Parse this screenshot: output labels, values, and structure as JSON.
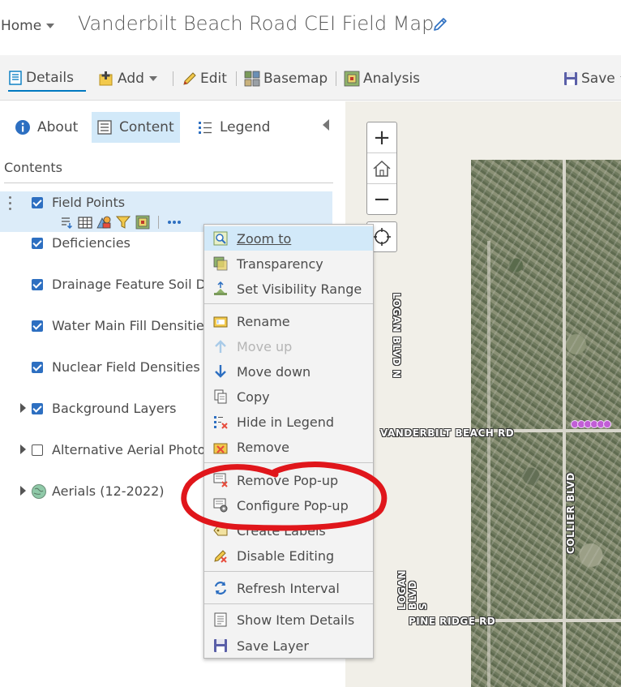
{
  "header": {
    "home_label": "Home",
    "map_title": "Vanderbilt Beach Road CEI Field Map"
  },
  "toolbar": {
    "details": "Details",
    "add": "Add",
    "edit": "Edit",
    "basemap": "Basemap",
    "analysis": "Analysis",
    "save": "Save"
  },
  "panel": {
    "tabs": {
      "about": "About",
      "content": "Content",
      "legend": "Legend"
    },
    "contents_label": "Contents",
    "layers": [
      {
        "name": "Field Points",
        "checked": true
      },
      {
        "name": "Deficiencies",
        "checked": true
      },
      {
        "name": "Drainage Feature Soil D",
        "checked": true
      },
      {
        "name": "Water Main Fill Densitie",
        "checked": true
      },
      {
        "name": "Nuclear Field Densities",
        "checked": true
      },
      {
        "name": "Background Layers",
        "checked": true
      },
      {
        "name": "Alternative Aerial Photo",
        "checked": false
      },
      {
        "name": "Aerials (12-2022)",
        "checked": true
      }
    ]
  },
  "context_menu": {
    "items": [
      {
        "label": "Zoom to",
        "icon": "zoom-to-icon"
      },
      {
        "label": "Transparency",
        "icon": "transparency-icon"
      },
      {
        "label": "Set Visibility Range",
        "icon": "visibility-range-icon"
      },
      {
        "label": "Rename",
        "icon": "rename-icon"
      },
      {
        "label": "Move up",
        "icon": "arrow-up-icon"
      },
      {
        "label": "Move down",
        "icon": "arrow-down-icon"
      },
      {
        "label": "Copy",
        "icon": "copy-icon"
      },
      {
        "label": "Hide in Legend",
        "icon": "hide-legend-icon"
      },
      {
        "label": "Remove",
        "icon": "remove-icon"
      },
      {
        "label": "Remove Pop-up",
        "icon": "remove-popup-icon"
      },
      {
        "label": "Configure Pop-up",
        "icon": "configure-popup-icon"
      },
      {
        "label": "Create Labels",
        "icon": "create-labels-icon"
      },
      {
        "label": "Disable Editing",
        "icon": "disable-editing-icon"
      },
      {
        "label": "Refresh Interval",
        "icon": "refresh-icon"
      },
      {
        "label": "Show Item Details",
        "icon": "item-details-icon"
      },
      {
        "label": "Save Layer",
        "icon": "save-layer-icon"
      }
    ]
  },
  "map": {
    "labels": {
      "logan_blvd_n": "LOGAN BLVD N",
      "vanderbilt_beach_rd": "VANDERBILT BEACH RD",
      "collier_blvd": "COLLIER BLVD",
      "logan_blvd_s": "LOGAN BLVD S",
      "pine_ridge_rd": "PINE RIDGE RD"
    },
    "zoom_in": "+",
    "zoom_out": "−"
  },
  "colors": {
    "accent": "#0079c1",
    "selected_bg": "#d2e9f9",
    "checkbox": "#2d6fc1",
    "annotation_red": "#e0161b"
  }
}
